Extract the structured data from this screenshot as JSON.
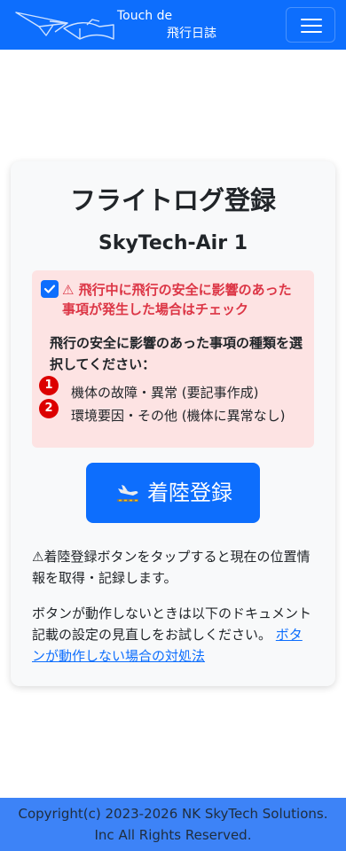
{
  "navbar": {
    "brand_line1": "Touch de",
    "brand_line2": "飛行日誌",
    "logo_icon": "paper-plane-book-icon",
    "menu_icon": "hamburger-menu-icon"
  },
  "card": {
    "title": "フライトログ登録",
    "aircraft": "SkyTech-Air 1"
  },
  "incident": {
    "checked": true,
    "warning_label": "⚠ 飛行中に飛行の安全に影響のあった事項が発生した場合はチェック",
    "prompt": "飛行の安全に影響のあった事項の種類を選択してください：",
    "options": [
      {
        "badge": "1",
        "label": "機体の故障・異常 (要記事作成)"
      },
      {
        "badge": "2",
        "label": "環境要因・その他 (機体に異常なし)"
      }
    ]
  },
  "landing_button": {
    "label": "着陸登録",
    "icon": "airplane-landing-icon"
  },
  "notes": {
    "location_note": "⚠着陸登録ボタンをタップすると現在の位置情報を取得・記録します。",
    "troubleshoot_note": "ボタンが動作しないときは以下のドキュメント記載の設定の見直しをお試しください。",
    "troubleshoot_link": "ボタンが動作しない場合の対処法"
  },
  "footer": {
    "line1": "Copyright(c) 2023-2026 NK SkyTech Solutions.",
    "line2": "Inc All Rights Reserved."
  },
  "colors": {
    "primary": "#0d6efd",
    "danger": "#dc3545",
    "alert_bg": "#fde3e3",
    "footer_bg": "#3d83f7"
  }
}
